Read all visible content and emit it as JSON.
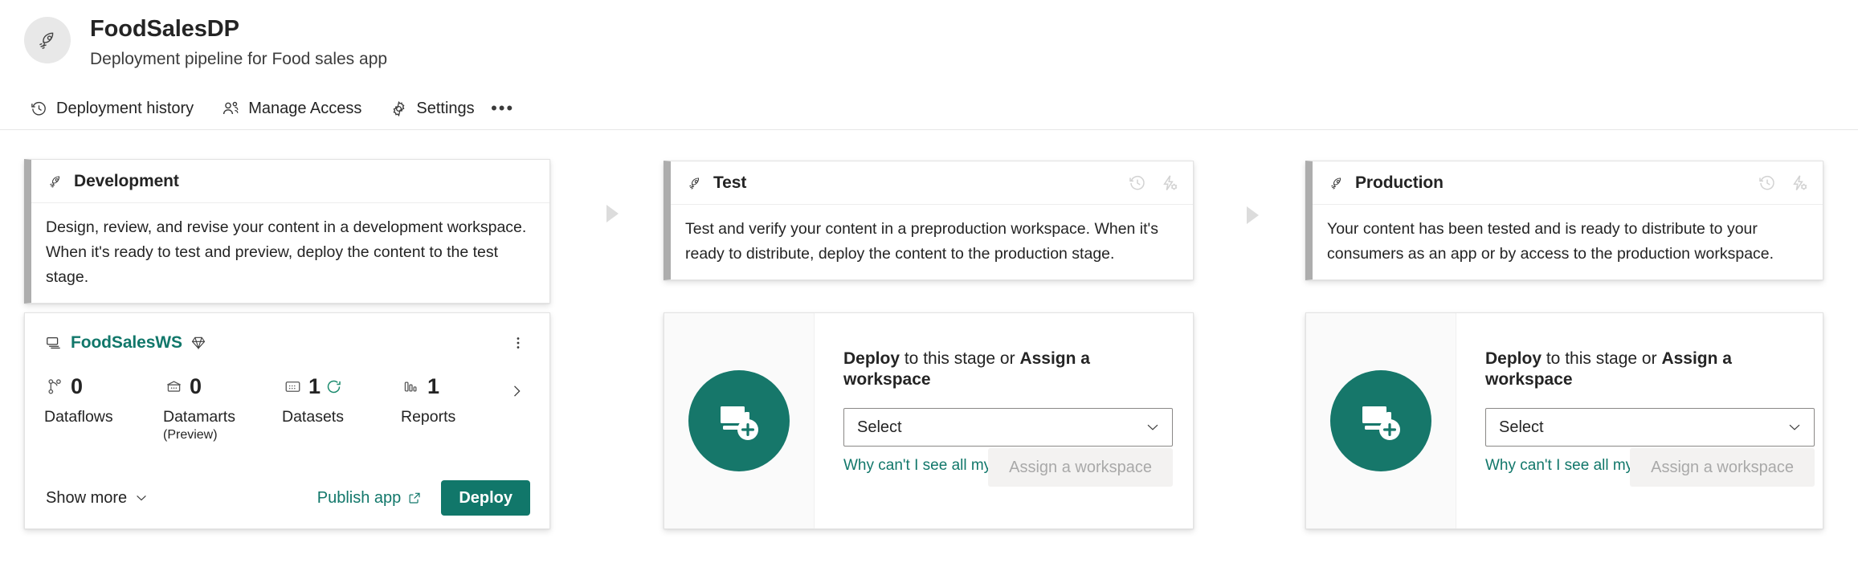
{
  "header": {
    "avatar_icon": "rocket-icon",
    "pipeline_name": "FoodSalesDP",
    "pipeline_subtitle": "Deployment pipeline for Food sales app",
    "toolbar": {
      "items": [
        {
          "label": "Deployment history",
          "icon": "history-icon"
        },
        {
          "label": "Manage Access",
          "icon": "people-icon"
        },
        {
          "label": "Settings",
          "icon": "gear-icon"
        }
      ],
      "overflow_label": "•••",
      "overflow_icon": "more-horizontal-icon"
    }
  },
  "stages": [
    {
      "title": "Development",
      "icon": "rocket-icon",
      "description": "Design, review, and revise your content in a development workspace. When it's ready to test and preview, deploy the content to the test stage.",
      "header_actions": []
    },
    {
      "title": "Test",
      "icon": "rocket-icon",
      "description": "Test and verify your content in a preproduction workspace. When it's ready to distribute, deploy the content to the production stage.",
      "header_actions": [
        {
          "icon": "deployment-history-icon"
        },
        {
          "icon": "deployment-rules-icon"
        }
      ]
    },
    {
      "title": "Production",
      "icon": "rocket-icon",
      "description": "Your content has been tested and is ready to distribute to your consumers as an app or by access to the production workspace.",
      "header_actions": [
        {
          "icon": "deployment-history-icon"
        },
        {
          "icon": "deployment-rules-icon"
        }
      ]
    }
  ],
  "workspace_card": {
    "stack_icon": "workspace-stack-icon",
    "name": "FoodSalesWS",
    "premium_icon": "premium-diamond-icon",
    "kebab_icon": "more-vertical-icon",
    "counters": [
      {
        "value": "0",
        "label": "Dataflows",
        "sublabel": "",
        "icon": "dataflow-icon",
        "refresh": false
      },
      {
        "value": "0",
        "label": "Datamarts",
        "sublabel": "(Preview)",
        "icon": "datamart-icon",
        "refresh": false
      },
      {
        "value": "1",
        "label": "Datasets",
        "sublabel": "",
        "icon": "dataset-icon",
        "refresh": true
      },
      {
        "value": "1",
        "label": "Reports",
        "sublabel": "",
        "icon": "report-icon",
        "refresh": false
      }
    ],
    "next_icon": "chevron-right-icon",
    "show_more_label": "Show more",
    "show_more_icon": "chevron-down-icon",
    "publish_app_label": "Publish app",
    "publish_app_icon": "external-link-icon",
    "deploy_label": "Deploy"
  },
  "empty_stage": {
    "illustration_icon": "assign-workspace-icon",
    "heading_deploy": "Deploy",
    "heading_middle": " to this stage or ",
    "heading_assign": "Assign a workspace",
    "select_value": "Select",
    "select_chevron_icon": "chevron-down-icon",
    "why_link": "Why can't I see all my workspaces?",
    "assign_button": "Assign a workspace"
  },
  "colors": {
    "accent_teal": "#11776a",
    "illustration_green": "#16776a",
    "stage_bar_grey": "#adadad",
    "arrow_grey": "#dcdcdc",
    "refresh_green": "#1a8a6d",
    "disabled_text": "#a9a9a9"
  }
}
